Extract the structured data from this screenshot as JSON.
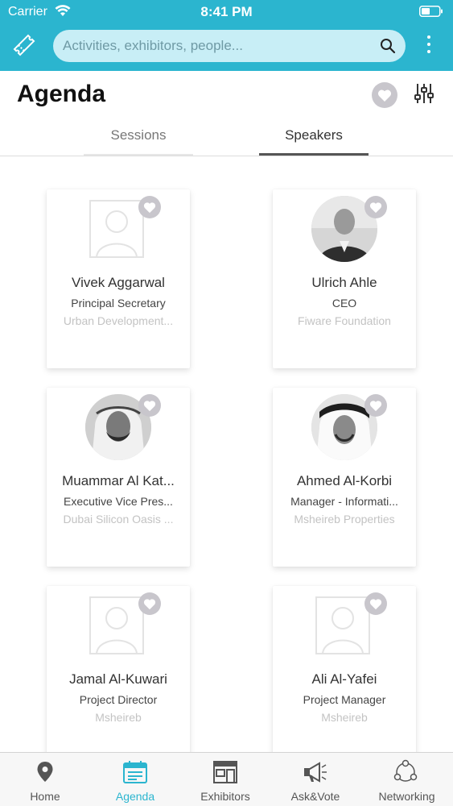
{
  "status_bar": {
    "carrier": "Carrier",
    "time": "8:41 PM"
  },
  "search": {
    "placeholder": "Activities, exhibitors, people..."
  },
  "page": {
    "title": "Agenda"
  },
  "tabs": [
    {
      "label": "Sessions",
      "active": false
    },
    {
      "label": "Speakers",
      "active": true
    }
  ],
  "speakers": [
    {
      "name": "Vivek Aggarwal",
      "title": "Principal Secretary",
      "company": "Urban Development...",
      "photo": "placeholder"
    },
    {
      "name": "Ulrich Ahle",
      "title": "CEO",
      "company": "Fiware Foundation",
      "photo": "portrait"
    },
    {
      "name": "Muammar Al Kat...",
      "title": "Executive Vice Pres...",
      "company": "Dubai Silicon Oasis ...",
      "photo": "portrait"
    },
    {
      "name": "Ahmed Al-Korbi",
      "title": "Manager - Informati...",
      "company": "Msheireb Properties",
      "photo": "portrait"
    },
    {
      "name": "Jamal Al-Kuwari",
      "title": "Project Director",
      "company": "Msheireb",
      "photo": "placeholder"
    },
    {
      "name": "Ali Al-Yafei",
      "title": "Project Manager",
      "company": "Msheireb",
      "photo": "placeholder"
    }
  ],
  "bottom_nav": [
    {
      "label": "Home",
      "icon": "map-pin-icon",
      "active": false
    },
    {
      "label": "Agenda",
      "icon": "calendar-icon",
      "active": true
    },
    {
      "label": "Exhibitors",
      "icon": "storefront-icon",
      "active": false
    },
    {
      "label": "Ask&Vote",
      "icon": "megaphone-icon",
      "active": false
    },
    {
      "label": "Networking",
      "icon": "network-icon",
      "active": false
    }
  ],
  "colors": {
    "accent": "#2bb5cf",
    "heart_bg": "#c8c6cc",
    "company_text": "#c3c3c3"
  }
}
